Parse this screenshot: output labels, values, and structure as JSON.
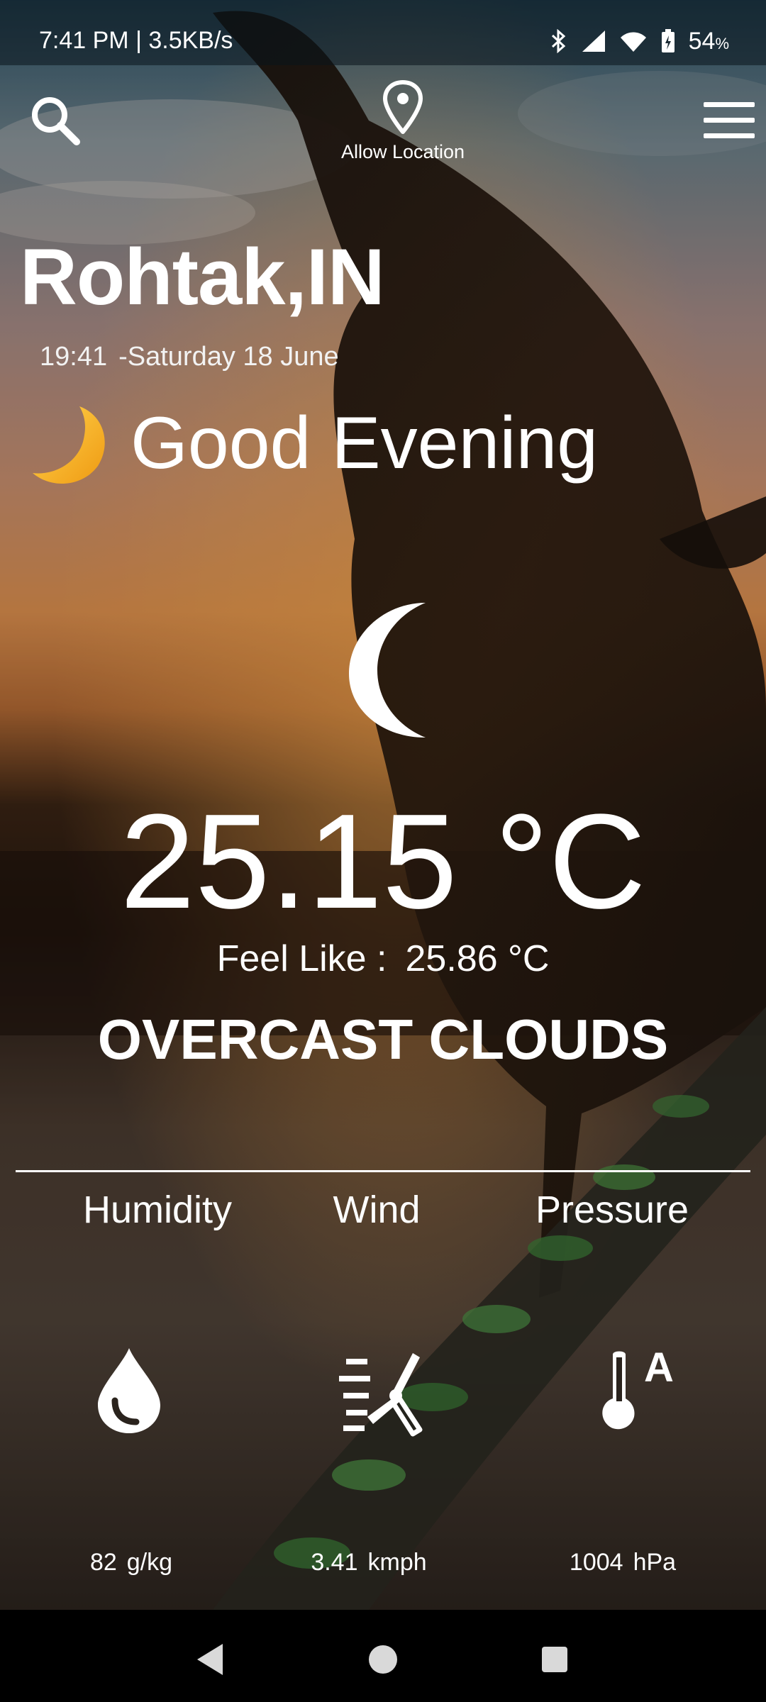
{
  "status_bar": {
    "time_speed": "7:41 PM | 3.5KB/s",
    "battery": "54",
    "battery_unit": "%"
  },
  "toolbar": {
    "location_label": "Allow Location"
  },
  "location": {
    "city": "Rohtak,IN",
    "time": "19:41",
    "date": "-Saturday 18 June"
  },
  "greeting": "Good Evening",
  "weather": {
    "temperature": "25.15 °C",
    "feels_label": "Feel Like :",
    "feels_value": "25.86 °C",
    "condition": "OVERCAST CLOUDS"
  },
  "stats": {
    "humidity": {
      "label": "Humidity",
      "value": "82",
      "unit": "g/kg",
      "icon": "water-drop-icon"
    },
    "wind": {
      "label": "Wind",
      "value": "3.41",
      "unit": "kmph",
      "icon": "wind-turbine-icon"
    },
    "pressure": {
      "label": "Pressure",
      "value": "1004",
      "unit": "hPa",
      "icon": "thermometer-icon"
    }
  },
  "colors": {
    "moon_emoji": "#f6b21c",
    "nav_bar": "#000000",
    "divider": "#ffffff"
  }
}
